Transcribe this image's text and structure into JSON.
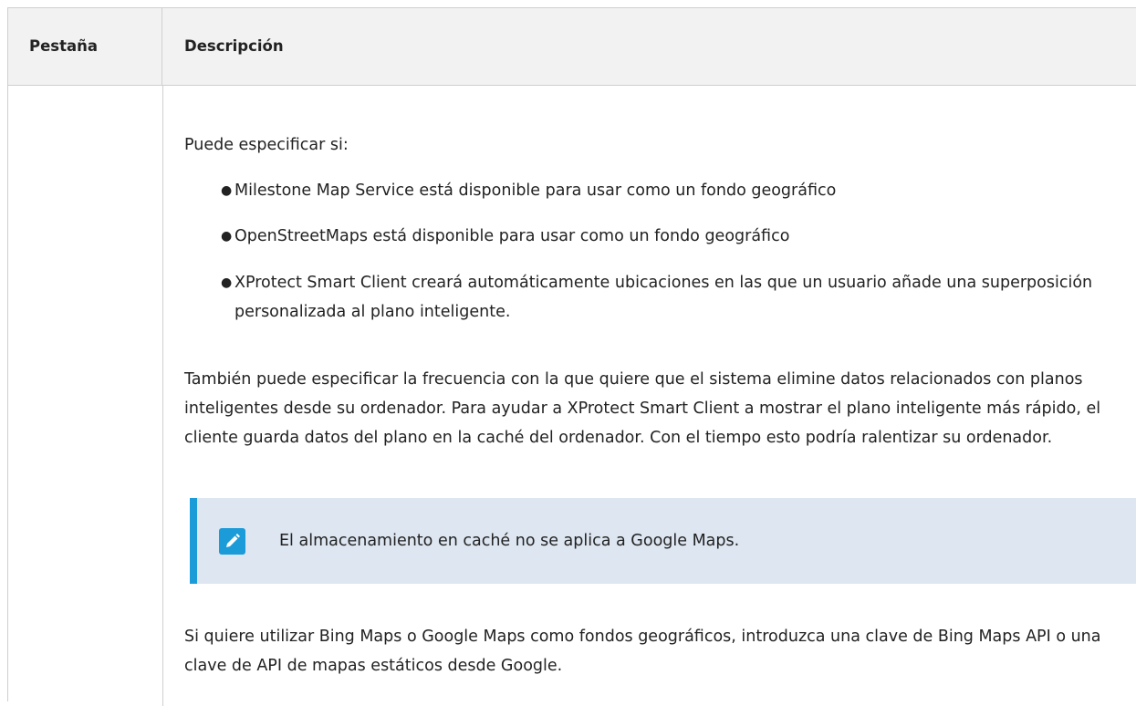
{
  "table": {
    "header": {
      "col1": "Pestaña",
      "col2": "Descripción"
    },
    "intro": "Puede especificar si:",
    "bullets": [
      "Milestone Map Service está disponible para usar como un fondo geográfico",
      "OpenStreetMaps está disponible para usar como un fondo geográfico",
      "XProtect Smart Client creará automáticamente ubicaciones en las que un usuario añade una superposición personalizada al plano inteligente."
    ],
    "frequency_paragraph": "También puede especificar la frecuencia con la que quiere que el sistema elimine datos relacionados con planos inteligentes desde su ordenador. Para ayudar a XProtect Smart Client a mostrar el plano inteligente más rápido, el cliente guarda datos del plano en la caché del ordenador. Con el tiempo esto podría ralentizar su ordenador.",
    "note": {
      "icon": "pencil-note-icon",
      "text": "El almacenamiento en caché no se aplica a Google Maps."
    },
    "keys_paragraph": "Si quiere utilizar Bing Maps o Google Maps como fondos geográficos, introduzca una clave de Bing Maps API o una clave de API de mapas estáticos desde Google."
  },
  "colors": {
    "header_bg": "#f2f2f2",
    "border": "#cfcfcf",
    "note_bg": "#dde6f1",
    "accent": "#1b9bd7",
    "text": "#222222"
  }
}
